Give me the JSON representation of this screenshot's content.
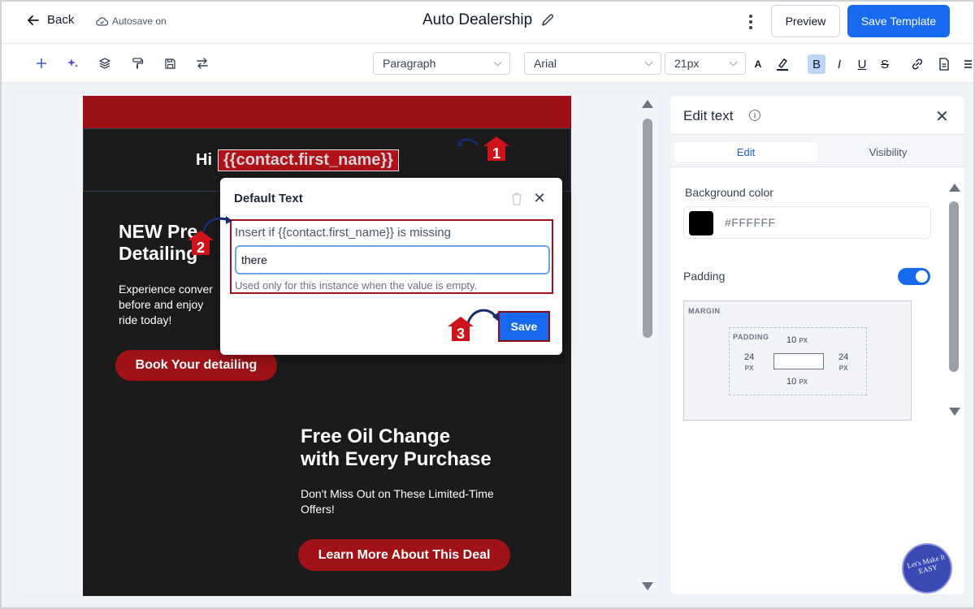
{
  "header": {
    "back_label": "Back",
    "autosave_label": "Autosave on",
    "title": "Auto Dealership",
    "preview_label": "Preview",
    "save_template_label": "Save Template"
  },
  "toolbar": {
    "block_type": "Paragraph",
    "font_family": "Arial",
    "font_size": "21px",
    "font_color_label": "A",
    "bold_label": "B",
    "italic_label": "I",
    "underline_label": "U",
    "strike_label": "S"
  },
  "email": {
    "greeting_prefix": "Hi",
    "merge_tag": "{{contact.first_name}}",
    "section1_title_line1": "NEW Pre",
    "section1_title_line2": "Detailing",
    "section1_body_line1": "Experience conver",
    "section1_body_line2": "before and enjoy",
    "section1_body_line3": "ride today!",
    "section1_button": "Book Your detailing",
    "section2_title_line1": "Free Oil Change",
    "section2_title_line2": "with Every Purchase",
    "section2_body_line1": "Don't Miss Out on These Limited-Time",
    "section2_body_line2": "Offers!",
    "section2_button": "Learn More About This Deal"
  },
  "popup": {
    "title": "Default Text",
    "field_label": "Insert if {{contact.first_name}} is missing",
    "field_value": "there",
    "help_text": "Used only for this instance when the value is empty.",
    "save_label": "Save"
  },
  "steps": [
    "1",
    "2",
    "3"
  ],
  "panel": {
    "title": "Edit text",
    "tab_edit": "Edit",
    "tab_visibility": "Visibility",
    "bg_color_label": "Background color",
    "bg_color_value": "#FFFFFF",
    "padding_label": "Padding",
    "padding_enabled": true,
    "margin_label": "MARGIN",
    "padding_box_label": "PADDING",
    "padding_top": "10",
    "padding_bottom": "10",
    "padding_left": "24",
    "padding_right": "24",
    "unit": "PX"
  },
  "logo_text": "Let's Make It EASY",
  "colors": {
    "primary": "#1769f0",
    "brand_red": "#a01217",
    "email_bg": "#1b1b1b",
    "annotation_red": "#d0121a"
  }
}
